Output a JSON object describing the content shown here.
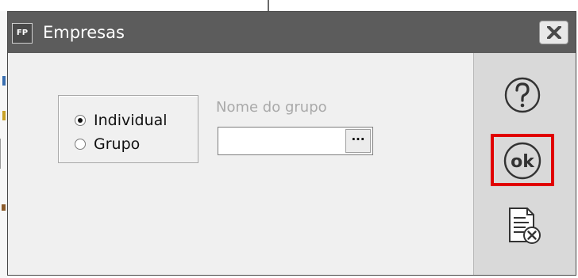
{
  "window": {
    "app_badge": "FP",
    "title": "Empresas"
  },
  "options": {
    "individual_label": "Individual",
    "grupo_label": "Grupo",
    "selected": "Individual"
  },
  "group_field": {
    "label": "Nome do grupo",
    "value": "",
    "browse_label": "···"
  },
  "toolbar": {
    "help": "help-icon",
    "ok": "ok-icon",
    "cancel": "cancel-document-icon"
  },
  "colors": {
    "titlebar": "#5c5c5c",
    "highlight": "#e00000"
  }
}
